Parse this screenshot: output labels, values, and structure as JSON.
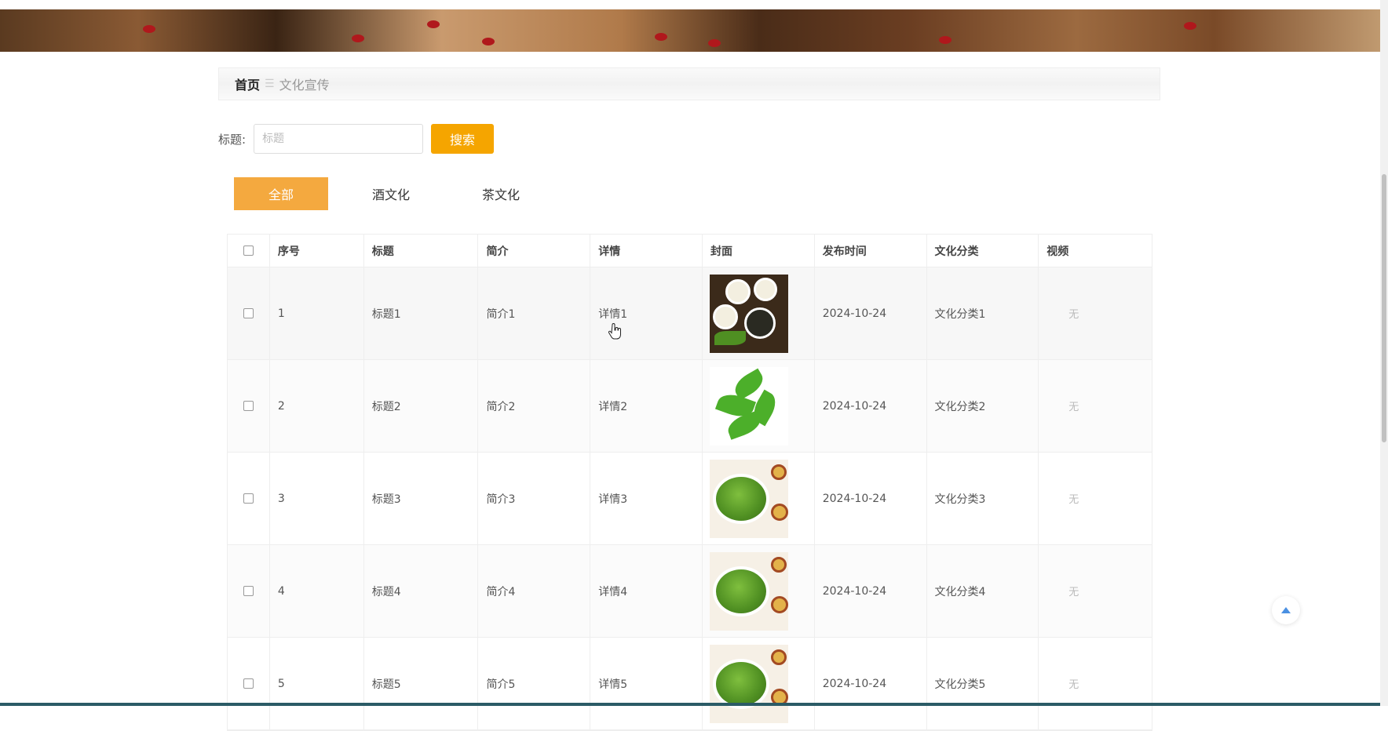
{
  "breadcrumb": {
    "home": "首页",
    "separator": "☰",
    "current": "文化宣传"
  },
  "search": {
    "label": "标题:",
    "placeholder": "标题",
    "value": "",
    "button_label": "搜索"
  },
  "tabs": [
    {
      "label": "全部",
      "active": true
    },
    {
      "label": "酒文化",
      "active": false
    },
    {
      "label": "茶文化",
      "active": false
    }
  ],
  "table": {
    "headers": [
      "序号",
      "标题",
      "简介",
      "详情",
      "封面",
      "发布时间",
      "文化分类",
      "视频"
    ],
    "rows": [
      {
        "index": "1",
        "title": "标题1",
        "intro": "简介1",
        "detail": "详情1",
        "cover": "tea-cups-image",
        "date": "2024-10-24",
        "category": "文化分类1",
        "video": "无"
      },
      {
        "index": "2",
        "title": "标题2",
        "intro": "简介2",
        "detail": "详情2",
        "cover": "tea-leaf-image",
        "date": "2024-10-24",
        "category": "文化分类2",
        "video": "无"
      },
      {
        "index": "3",
        "title": "标题3",
        "intro": "简介3",
        "detail": "详情3",
        "cover": "green-tea-image",
        "date": "2024-10-24",
        "category": "文化分类3",
        "video": "无"
      },
      {
        "index": "4",
        "title": "标题4",
        "intro": "简介4",
        "detail": "详情4",
        "cover": "green-tea-image",
        "date": "2024-10-24",
        "category": "文化分类4",
        "video": "无"
      },
      {
        "index": "5",
        "title": "标题5",
        "intro": "简介5",
        "detail": "详情5",
        "cover": "green-tea-image",
        "date": "2024-10-24",
        "category": "文化分类5",
        "video": "无"
      }
    ]
  },
  "colors": {
    "accent": "#f5a500",
    "tab_active": "#f4a93f",
    "to_top_arrow": "#4a90e2"
  },
  "icons": {
    "to_top": "up-triangle-icon",
    "cursor": "hand-pointer-icon"
  }
}
